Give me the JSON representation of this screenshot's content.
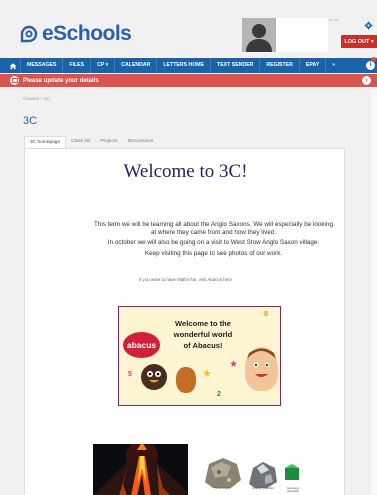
{
  "brand": {
    "name": "eSchools"
  },
  "user": {
    "tiny_label": "St. Jon",
    "logout_label": "LOG OUT ▾"
  },
  "nav": {
    "items": [
      "MESSAGES",
      "FILES",
      "CP ▾",
      "CALENDAR",
      "LETTERS HOME",
      "TEXT SENDER",
      "REGISTER",
      "EPAY",
      "»"
    ],
    "info_label": "i"
  },
  "alert": {
    "text": "Please update your details",
    "arrow": "›"
  },
  "breadcrumb": "Classes  »  3C",
  "page_title": "3C",
  "tabs": [
    "3C homepage",
    "Class list",
    "Projects",
    "Discussions"
  ],
  "content": {
    "welcome": "Welcome to 3C!",
    "paragraphs": [
      "This term we will be learning all about the Anglo Saxons. We will especially be looking at where they came from and how they lived.",
      "In october we will also be going on a visit to West Stow Anglo Saxon village.",
      "Keep visiting this page to see photos of our work."
    ],
    "maths_line": "If you want to have Maths fun, visit Abacus here",
    "abacus": {
      "badge": "abacus",
      "line1": "Welcome to the",
      "line2": "wonderful world",
      "line3": "of Abacus!",
      "numbers": [
        "8",
        "5",
        "2"
      ]
    },
    "rock_labels": [
      "Rock Granite",
      "Mineral (Quartzite)",
      "Gemstone (Emerald)"
    ]
  },
  "colors": {
    "nav": "#1a63a8",
    "alert": "#d9534f",
    "logout": "#c9302c",
    "brand": "#2d5eaa",
    "welcome": "#23236b"
  }
}
